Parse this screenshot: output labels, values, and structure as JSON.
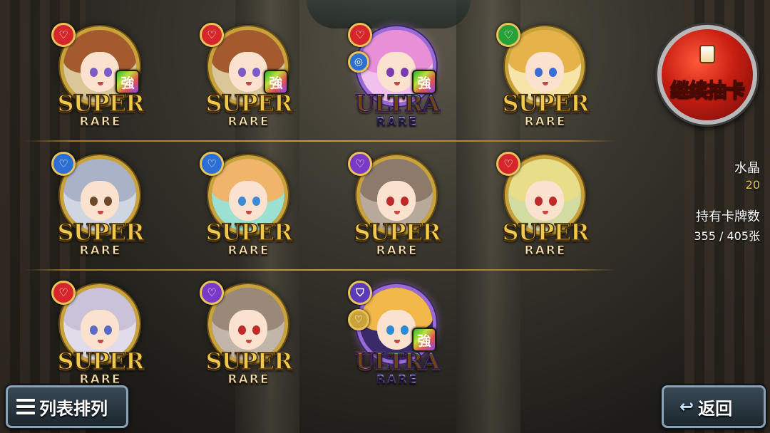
{
  "cards": [
    {
      "rarity_top": "SUPER",
      "rarity_bottom": "RARE",
      "attribute": "♡",
      "attr_color": "#d7262b",
      "strong": "強",
      "hair": "#a35b2e",
      "bg": "#d9c79a",
      "eyes": "#7b5cc9",
      "ultra": false
    },
    {
      "rarity_top": "SUPER",
      "rarity_bottom": "RARE",
      "attribute": "♡",
      "attr_color": "#d7262b",
      "strong": "強",
      "hair": "#a35b2e",
      "bg": "#d9c79a",
      "eyes": "#7b5cc9",
      "ultra": false
    },
    {
      "rarity_top": "ULTRA",
      "rarity_bottom": "RARE",
      "attribute": "♡",
      "attr_color": "#d7262b",
      "attribute2": "◎",
      "attr2_color": "#2a6ed6",
      "strong": "強",
      "hair": "#e88fd8",
      "bg": "#f2c0ee",
      "eyes": "#7a3ab0",
      "ultra": true
    },
    {
      "rarity_top": "SUPER",
      "rarity_bottom": "RARE",
      "attribute": "♡",
      "attr_color": "#28a03a",
      "strong": "",
      "hair": "#e6b24a",
      "bg": "#f6e4a8",
      "eyes": "#3a6ed6",
      "ultra": false
    },
    {
      "rarity_top": "SUPER",
      "rarity_bottom": "RARE",
      "attribute": "♡",
      "attr_color": "#2a6ed6",
      "strong": "",
      "hair": "#a9b2c6",
      "bg": "#cfd6e2",
      "eyes": "#6b4a2a",
      "ultra": false
    },
    {
      "rarity_top": "SUPER",
      "rarity_bottom": "RARE",
      "attribute": "♡",
      "attr_color": "#2a6ed6",
      "strong": "",
      "hair": "#f0b46a",
      "bg": "#9be0d0",
      "eyes": "#3a8ad6",
      "ultra": false
    },
    {
      "rarity_top": "SUPER",
      "rarity_bottom": "RARE",
      "attribute": "♡",
      "attr_color": "#7a3ac8",
      "strong": "",
      "hair": "#8d7a6a",
      "bg": "#b8aa9a",
      "eyes": "#c02a2a",
      "ultra": false
    },
    {
      "rarity_top": "SUPER",
      "rarity_bottom": "RARE",
      "attribute": "♡",
      "attr_color": "#d7262b",
      "strong": "",
      "hair": "#e8de8a",
      "bg": "#d2dca0",
      "eyes": "#c02a2a",
      "ultra": false
    },
    {
      "rarity_top": "SUPER",
      "rarity_bottom": "RARE",
      "attribute": "♡",
      "attr_color": "#d7262b",
      "strong": "",
      "hair": "#c9c2d8",
      "bg": "#e0dcea",
      "eyes": "#5a6ac8",
      "ultra": false
    },
    {
      "rarity_top": "SUPER",
      "rarity_bottom": "RARE",
      "attribute": "♡",
      "attr_color": "#7a3ac8",
      "strong": "",
      "hair": "#9a8878",
      "bg": "#c2b6aa",
      "eyes": "#c02a2a",
      "ultra": false
    },
    {
      "rarity_top": "ULTRA",
      "rarity_bottom": "RARE",
      "attribute": "⛉",
      "attr_color": "#5a3ab8",
      "attribute2": "♡",
      "attr2_color": "#c9a23a",
      "strong": "強",
      "hair": "#f2b84a",
      "bg": "#3a2a6a",
      "eyes": "#2a8ad6",
      "ultra": true
    }
  ],
  "continue_button": {
    "label": "继续抽卡"
  },
  "stats": {
    "crystal_label": "水晶",
    "crystal_value": "20",
    "cards_owned_label": "持有卡牌数",
    "cards_owned_value": "355 / 405张"
  },
  "sort_button": {
    "label": "列表排列"
  },
  "back_button": {
    "label": "返回"
  }
}
